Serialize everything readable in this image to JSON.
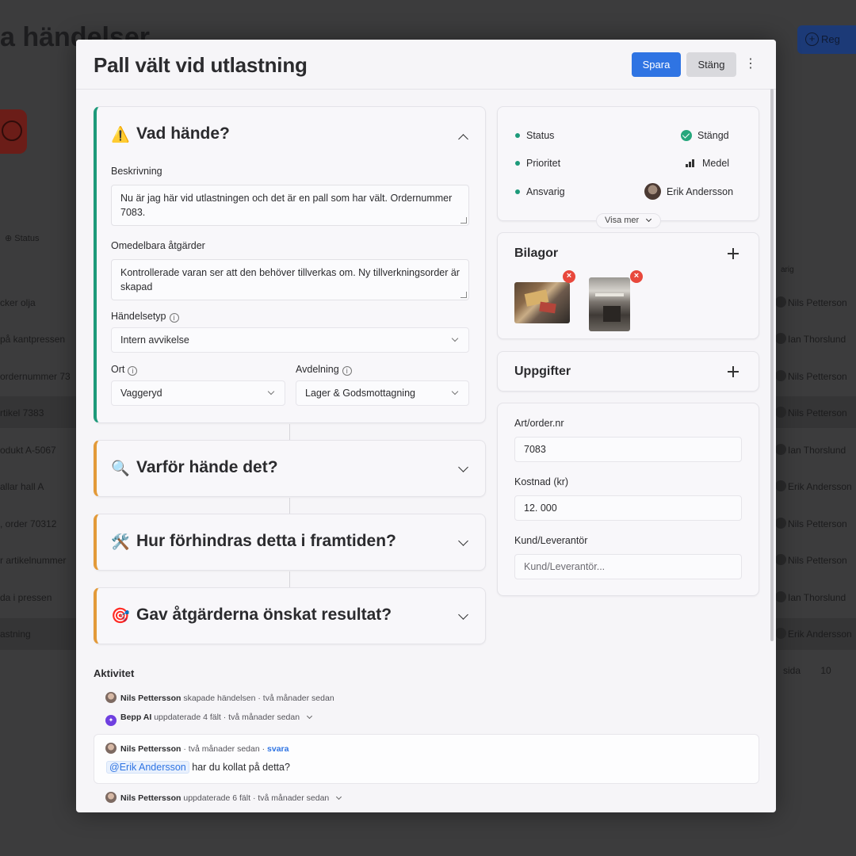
{
  "background": {
    "page_title": "a händelser",
    "new_button_label": "Reg",
    "status_filter": "Status",
    "owner_header": "arig",
    "rows": [
      {
        "left": "cker olja",
        "right": "Nils Petterson"
      },
      {
        "left": "på kantpressen",
        "right": "Ian Thorslund"
      },
      {
        "left": "ordernummer 73",
        "right": "Nils Petterson"
      },
      {
        "left": "rtikel 7383",
        "right": "Nils Petterson"
      },
      {
        "left": "odukt A-5067",
        "right": "Ian Thorslund"
      },
      {
        "left": "allar hall A",
        "right": "Erik Andersson"
      },
      {
        "left": ", order 70312",
        "right": "Nils Petterson"
      },
      {
        "left": "r artikelnummer",
        "right": "Nils Petterson"
      },
      {
        "left": "da i pressen",
        "right": "Ian Thorslund"
      },
      {
        "left": "astning",
        "right": "Erik Andersson"
      }
    ],
    "pager_label": "sida",
    "pager_value": "10"
  },
  "modal": {
    "title": "Pall vält vid utlastning",
    "save_label": "Spara",
    "close_label": "Stäng",
    "more_icon": "⋮"
  },
  "sections": [
    {
      "emoji": "⚠️",
      "title": "Vad hände?",
      "accent": "#1d9a7a",
      "expanded": true
    },
    {
      "emoji": "🔍",
      "title": "Varför hände det?",
      "accent": "#e39a39",
      "expanded": false
    },
    {
      "emoji": "🛠️",
      "title": "Hur förhindras detta i framtiden?",
      "accent": "#e39a39",
      "expanded": false
    },
    {
      "emoji": "🎯",
      "title": "Gav åtgärderna önskat resultat?",
      "accent": "#e39a39",
      "expanded": false
    }
  ],
  "what_happened": {
    "description_label": "Beskrivning",
    "description_value": "Nu är jag här vid utlastningen och det är en pall som har vält. Ordernummer 7083.",
    "actions_label": "Omedelbara åtgärder",
    "actions_value": "Kontrollerade varan ser att den behöver tillverkas om. Ny tillverkningsorder är skapad",
    "type_label": "Händelsetyp",
    "type_value": "Intern avvikelse",
    "location_label": "Ort",
    "location_value": "Vaggeryd",
    "department_label": "Avdelning",
    "department_value": "Lager & Godsmottagning"
  },
  "properties": {
    "status_label": "Status",
    "status_value": "Stängd",
    "priority_label": "Prioritet",
    "priority_value": "Medel",
    "owner_label": "Ansvarig",
    "owner_value": "Erik Andersson",
    "show_more_label": "Visa mer"
  },
  "attachments": {
    "title": "Bilagor",
    "remove_symbol": "×"
  },
  "tasks": {
    "title": "Uppgifter"
  },
  "details": {
    "order_label": "Art/order.nr",
    "order_value": "7083",
    "cost_label": "Kostnad (kr)",
    "cost_value": "12. 000",
    "customer_label": "Kund/Leverantör",
    "customer_placeholder": "Kund/Leverantör..."
  },
  "activity": {
    "title": "Aktivitet",
    "items": [
      {
        "author": "Nils Pettersson",
        "text": " skapade händelsen · två månader sedan"
      },
      {
        "author": "Bepp AI",
        "text": " uppdaterade 4 fält · två månader sedan"
      },
      {
        "author": "Nils Pettersson",
        "text": " uppdaterade 6 fält · två månader sedan"
      }
    ],
    "comment": {
      "author": "Nils Pettersson",
      "meta": " · två månader sedan · ",
      "reply": "svara",
      "mention": "@Erik Andersson",
      "body": " har du kollat på detta?"
    }
  }
}
